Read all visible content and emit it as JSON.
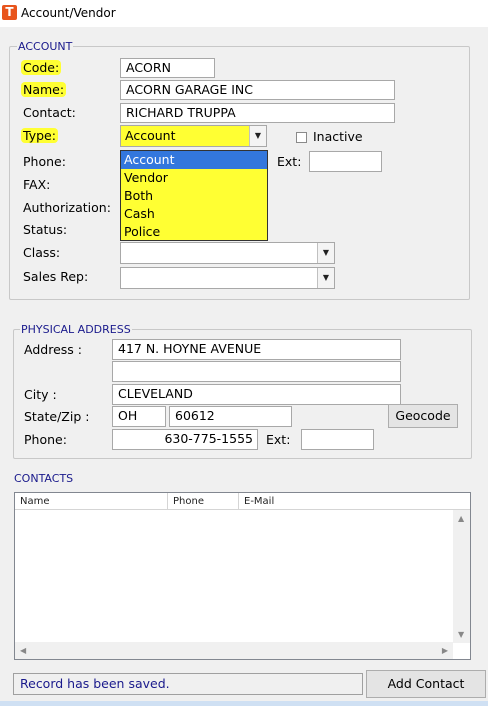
{
  "window": {
    "title": "Account/Vendor"
  },
  "account": {
    "legend": "ACCOUNT",
    "code_label": "Code:",
    "code_value": "ACORN",
    "name_label": "Name:",
    "name_value": "ACORN GARAGE INC",
    "contact_label": "Contact:",
    "contact_value": "RICHARD TRUPPA",
    "type_label": "Type:",
    "type_value": "Account",
    "type_options": [
      "Account",
      "Vendor",
      "Both",
      "Cash",
      "Police"
    ],
    "inactive_label": "Inactive",
    "phone_label": "Phone:",
    "ext_label": "Ext:",
    "fax_label": "FAX:",
    "authorization_label": "Authorization:",
    "status_label": "Status:",
    "class_label": "Class:",
    "sales_rep_label": "Sales Rep:"
  },
  "physical_address": {
    "legend": "PHYSICAL ADDRESS",
    "address_label": "Address :",
    "address_line1": "417 N. HOYNE AVENUE",
    "address_line2": "",
    "city_label": "City :",
    "city_value": "CLEVELAND",
    "state_zip_label": "State/Zip :",
    "state_value": "OH",
    "zip_value": "60612",
    "geocode_label": "Geocode",
    "phone_label": "Phone:",
    "phone_value": "630-775-1555",
    "ext_label": "Ext:"
  },
  "contacts": {
    "legend": "CONTACTS",
    "columns": [
      "Name",
      "Phone",
      "E-Mail"
    ]
  },
  "status": {
    "message": "Record has been saved."
  },
  "actions": {
    "add_contact_label": "Add Contact"
  },
  "colors": {
    "highlight": "#ffff33",
    "selection": "#3377dd",
    "legend_text": "#1a1a8c",
    "app_icon": "#e8541c"
  },
  "icons": {
    "app": "t-logo-icon",
    "combo_arrow": "chevron-down-icon"
  }
}
